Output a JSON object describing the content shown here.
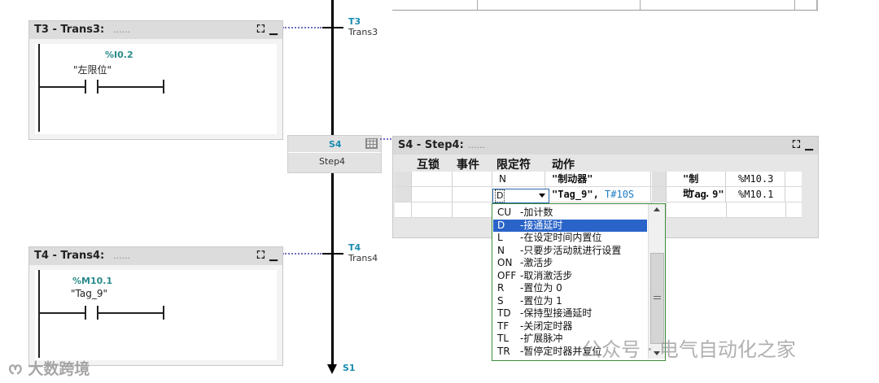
{
  "transitions": [
    {
      "title": "T3 - Trans3:",
      "dots": "......",
      "address": "%I0.2",
      "tag": "\"左限位\"",
      "flow_label": "T3",
      "flow_name": "Trans3"
    },
    {
      "title": "T4 - Trans4:",
      "dots": "......",
      "address": "%M10.1",
      "tag": "\"Tag_9\"",
      "flow_label": "T4",
      "flow_name": "Trans4"
    }
  ],
  "step": {
    "num": "S4",
    "name": "Step4",
    "panel_title": "S4 - Step4:",
    "panel_dots": "......"
  },
  "columns": {
    "interlock": "互锁",
    "event": "事件",
    "qualifier": "限定符",
    "action": "动作"
  },
  "rows": [
    {
      "qualifier": "N",
      "action": "\"制动器\"",
      "tag": "\"制动...",
      "address": "%M10.3"
    },
    {
      "qualifier": "D",
      "action": "\"Tag_9\",",
      "time": "T#10S",
      "tag": "\"Tag 9\"",
      "address": "%M10.1"
    }
  ],
  "qualifier_options": [
    {
      "code": "CU",
      "desc": "-加计数"
    },
    {
      "code": "D",
      "desc": "-接通延时",
      "selected": true
    },
    {
      "code": "L",
      "desc": "-在设定时间内置位"
    },
    {
      "code": "N",
      "desc": "-只要步活动就进行设置"
    },
    {
      "code": "ON",
      "desc": "-激活步"
    },
    {
      "code": "OFF",
      "desc": "-取消激活步"
    },
    {
      "code": "R",
      "desc": "-置位为 0"
    },
    {
      "code": "S",
      "desc": "-置位为 1"
    },
    {
      "code": "TD",
      "desc": "-保持型接通延时"
    },
    {
      "code": "TF",
      "desc": "-关闭定时器"
    },
    {
      "code": "TL",
      "desc": "-扩展脉冲"
    },
    {
      "code": "TR",
      "desc": "-暂停定时器并复位"
    }
  ],
  "end_label": "S1",
  "watermarks": {
    "right": "公众号 · 电气自动化之家",
    "left": "大数跨境"
  },
  "icons": {
    "expand": "expand-icon",
    "minimize": "minimize-icon",
    "grid": "grid-icon"
  },
  "colors": {
    "address": "#2a8a8a",
    "step_label": "#1a8cb0",
    "selection": "#2a64c8",
    "dropdown_border": "#3c8c3c"
  }
}
